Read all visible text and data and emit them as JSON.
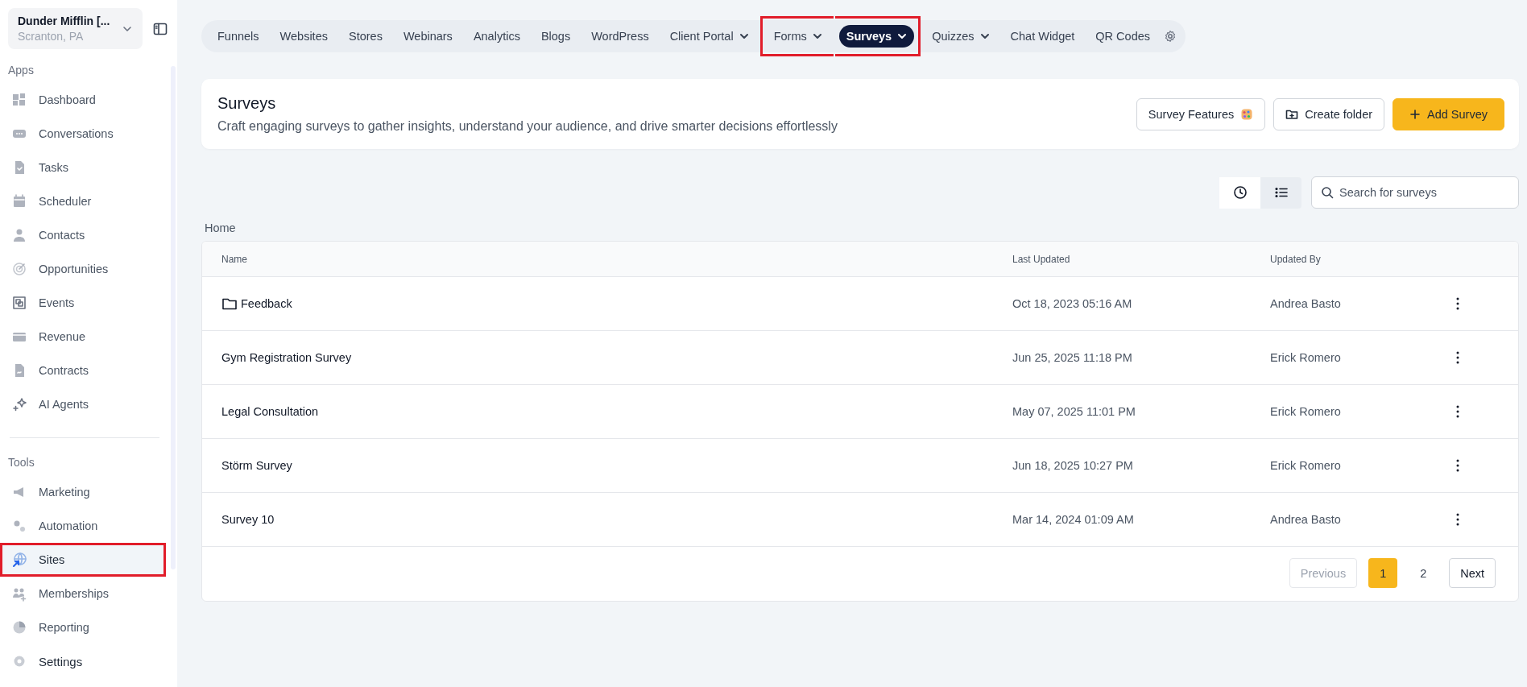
{
  "account": {
    "name": "Dunder Mifflin [...",
    "location": "Scranton, PA"
  },
  "sidebar": {
    "sections": [
      {
        "title": "Apps",
        "items": [
          {
            "label": "Dashboard",
            "selected": false,
            "highlighted": false
          },
          {
            "label": "Conversations",
            "selected": false,
            "highlighted": false
          },
          {
            "label": "Tasks",
            "selected": false,
            "highlighted": false
          },
          {
            "label": "Scheduler",
            "selected": false,
            "highlighted": false
          },
          {
            "label": "Contacts",
            "selected": false,
            "highlighted": false
          },
          {
            "label": "Opportunities",
            "selected": false,
            "highlighted": false
          },
          {
            "label": "Events",
            "selected": false,
            "highlighted": false
          },
          {
            "label": "Revenue",
            "selected": false,
            "highlighted": false
          },
          {
            "label": "Contracts",
            "selected": false,
            "highlighted": false
          },
          {
            "label": "AI Agents",
            "selected": false,
            "highlighted": false
          }
        ]
      },
      {
        "title": "Tools",
        "items": [
          {
            "label": "Marketing",
            "selected": false,
            "highlighted": false
          },
          {
            "label": "Automation",
            "selected": false,
            "highlighted": false
          },
          {
            "label": "Sites",
            "selected": true,
            "highlighted": true
          },
          {
            "label": "Memberships",
            "selected": false,
            "highlighted": false
          },
          {
            "label": "Reporting",
            "selected": false,
            "highlighted": false
          }
        ]
      }
    ],
    "footer_item": {
      "label": "Settings"
    }
  },
  "top_nav": [
    {
      "label": "Funnels",
      "selected": false,
      "dropdown": false,
      "highlighted": false
    },
    {
      "label": "Websites",
      "selected": false,
      "dropdown": false,
      "highlighted": false
    },
    {
      "label": "Stores",
      "selected": false,
      "dropdown": false,
      "highlighted": false
    },
    {
      "label": "Webinars",
      "selected": false,
      "dropdown": false,
      "highlighted": false
    },
    {
      "label": "Analytics",
      "selected": false,
      "dropdown": false,
      "highlighted": false
    },
    {
      "label": "Blogs",
      "selected": false,
      "dropdown": false,
      "highlighted": false
    },
    {
      "label": "WordPress",
      "selected": false,
      "dropdown": false,
      "highlighted": false
    },
    {
      "label": "Client Portal",
      "selected": false,
      "dropdown": true,
      "highlighted": false
    },
    {
      "label": "Forms",
      "selected": false,
      "dropdown": true,
      "highlighted": true
    },
    {
      "label": "Surveys",
      "selected": true,
      "dropdown": true,
      "highlighted": true
    },
    {
      "label": "Quizzes",
      "selected": false,
      "dropdown": true,
      "highlighted": false
    },
    {
      "label": "Chat Widget",
      "selected": false,
      "dropdown": false,
      "highlighted": false
    },
    {
      "label": "QR Codes",
      "selected": false,
      "dropdown": false,
      "highlighted": false
    }
  ],
  "header": {
    "title": "Surveys",
    "subtitle": "Craft engaging surveys to gather insights, understand your audience, and drive smarter decisions effortlessly",
    "buttons": [
      {
        "label": "Survey Features",
        "kind": "features"
      },
      {
        "label": "Create folder",
        "kind": "folder"
      },
      {
        "label": "Add Survey",
        "kind": "primary"
      }
    ]
  },
  "view_toggle": [
    {
      "kind": "recent",
      "selected": true
    },
    {
      "kind": "list",
      "selected": false
    }
  ],
  "search": {
    "placeholder": "Search for surveys"
  },
  "breadcrumb": "Home",
  "table": {
    "columns": [
      "Name",
      "Last Updated",
      "Updated By"
    ],
    "rows": [
      {
        "kind": "folder",
        "name": "Feedback",
        "updated": "Oct 18, 2023 05:16 AM",
        "by": "Andrea Basto"
      },
      {
        "kind": "survey",
        "name": "Gym Registration Survey",
        "updated": "Jun 25, 2025 11:18 PM",
        "by": "Erick Romero"
      },
      {
        "kind": "survey",
        "name": "Legal Consultation",
        "updated": "May 07, 2025 11:01 PM",
        "by": "Erick Romero"
      },
      {
        "kind": "survey",
        "name": "Störm Survey",
        "updated": "Jun 18, 2025 10:27 PM",
        "by": "Erick Romero"
      },
      {
        "kind": "survey",
        "name": "Survey 10",
        "updated": "Mar 14, 2024 01:09 AM",
        "by": "Andrea Basto"
      }
    ]
  },
  "pagination": {
    "previous": {
      "label": "Previous",
      "disabled": true
    },
    "pages": [
      {
        "label": "1",
        "selected": true
      },
      {
        "label": "2",
        "selected": false
      }
    ],
    "next": {
      "label": "Next",
      "disabled": false
    }
  }
}
